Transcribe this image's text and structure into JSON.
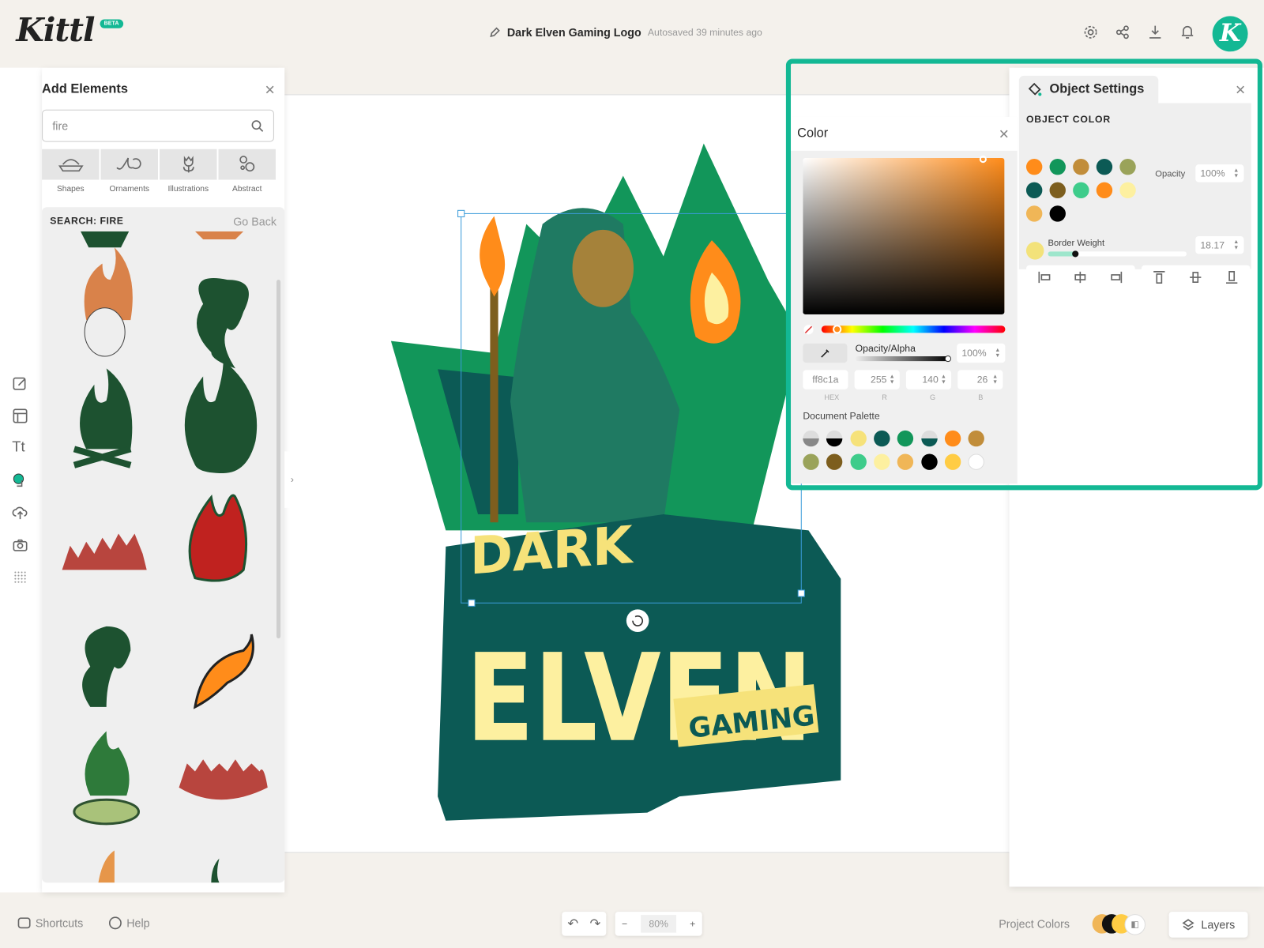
{
  "app": {
    "logo": "Kittl",
    "badge": "BETA"
  },
  "header": {
    "title": "Dark Elven Gaming Logo",
    "autosave": "Autosaved 39 minutes ago",
    "avatar_letter": "K",
    "icons": [
      "settings-icon",
      "share-icon",
      "download-icon",
      "bell-icon"
    ]
  },
  "rail": {
    "icons": [
      "edit-icon",
      "layout-icon",
      "text-icon",
      "elements-icon",
      "upload-icon",
      "camera-icon",
      "pattern-icon"
    ],
    "text_icon_label": "Tt"
  },
  "add_elements": {
    "title": "Add Elements",
    "search_value": "fire",
    "categories": [
      {
        "label": "Shapes"
      },
      {
        "label": "Ornaments"
      },
      {
        "label": "Illustrations"
      },
      {
        "label": "Abstract"
      }
    ],
    "results_label": "SEARCH: FIRE",
    "go_back": "Go Back"
  },
  "canvas": {
    "logo_text": {
      "line1": "DARK",
      "line2": "ELVEN",
      "line3": "GAMING"
    }
  },
  "color_picker": {
    "title": "Color",
    "opacity_label": "Opacity/Alpha",
    "opacity": "100%",
    "hex": "ff8c1a",
    "r": "255",
    "g": "140",
    "b": "26",
    "labels": {
      "hex": "HEX",
      "r": "R",
      "g": "G",
      "b": "B"
    },
    "palette_title": "Document Palette",
    "palette": [
      "#888888",
      "#000000",
      "#f6e27a",
      "#0c5a55",
      "#12965a",
      "#0c5a55",
      "#ff8c1a",
      "#c18d3a",
      "#9aa35a",
      "#7d5e1e",
      "#3ecc8b",
      "#fdf0a0",
      "#f0b657",
      "#000000",
      "#ffcc44",
      "#ffffff"
    ]
  },
  "object_settings": {
    "title": "Object Settings",
    "section": "OBJECT COLOR",
    "colors": [
      "#ff8c1a",
      "#12965a",
      "#c18d3a",
      "#0c5a55",
      "#9aa35a",
      "#0c5a55",
      "#7d5e1e",
      "#3ecc8b",
      "#ff8c1a",
      "#fdf0a0",
      "#f0b657",
      "#000000"
    ],
    "opacity_label": "Opacity",
    "opacity": "100%",
    "border_label": "Border Weight",
    "border_value": "18.17",
    "border_color": "#f3e27a",
    "align_icons": [
      "align-left-icon",
      "align-center-h-icon",
      "align-right-icon",
      "align-top-icon",
      "align-middle-icon",
      "align-bottom-icon"
    ]
  },
  "footer": {
    "shortcuts": "Shortcuts",
    "help": "Help",
    "zoom": "80%",
    "project_colors": "Project Colors",
    "layers": "Layers"
  },
  "accent": "#13b894"
}
